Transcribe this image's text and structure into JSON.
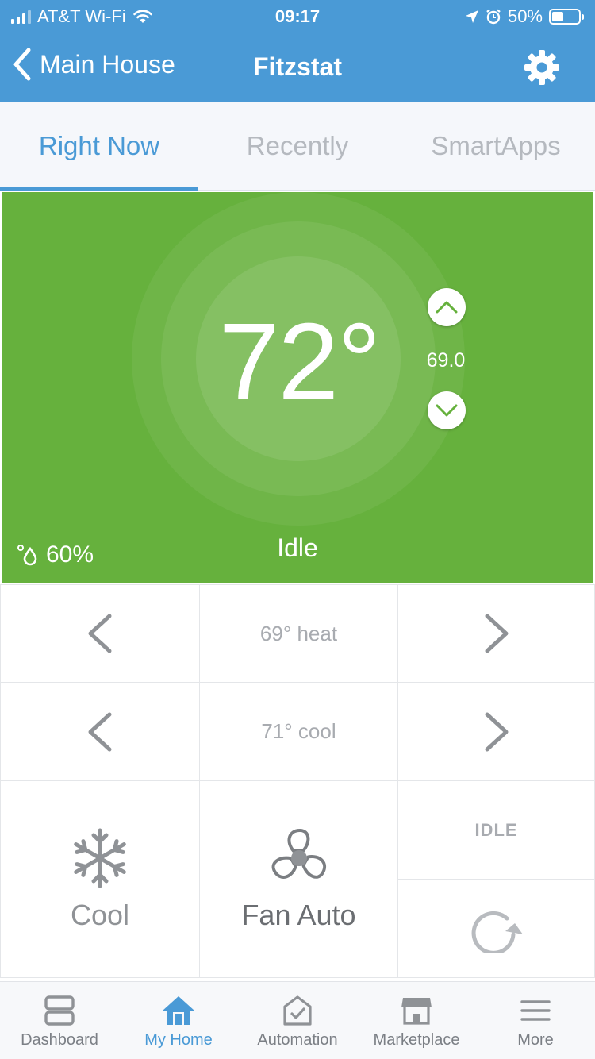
{
  "status_bar": {
    "carrier": "AT&T Wi-Fi",
    "time": "09:17",
    "battery": "50%",
    "icons": [
      "signal-icon",
      "wifi-icon",
      "location-icon",
      "alarm-icon",
      "battery-icon"
    ]
  },
  "nav": {
    "back_label": "Main House",
    "title": "Fitzstat",
    "settings_icon": "gear-icon"
  },
  "tabs": [
    {
      "label": "Right Now",
      "active": true
    },
    {
      "label": "Recently",
      "active": false
    },
    {
      "label": "SmartApps",
      "active": false
    }
  ],
  "thermostat": {
    "current_temp": "72°",
    "setpoint": "69.0",
    "humidity": "60%",
    "state": "Idle",
    "panel_color": "#66B13D"
  },
  "controls": {
    "heat_setpoint": "69° heat",
    "cool_setpoint": "71° cool",
    "mode_label": "Cool",
    "fan_label": "Fan Auto",
    "operating_state": "IDLE"
  },
  "tabbar": {
    "items": [
      {
        "label": "Dashboard",
        "icon": "dashboard-icon",
        "active": false
      },
      {
        "label": "My Home",
        "icon": "home-icon",
        "active": true
      },
      {
        "label": "Automation",
        "icon": "automation-icon",
        "active": false
      },
      {
        "label": "Marketplace",
        "icon": "marketplace-icon",
        "active": false
      },
      {
        "label": "More",
        "icon": "menu-icon",
        "active": false
      }
    ]
  },
  "colors": {
    "accent": "#4A9AD6",
    "idle_green": "#66B13D",
    "icon_gray": "#8F9296"
  }
}
